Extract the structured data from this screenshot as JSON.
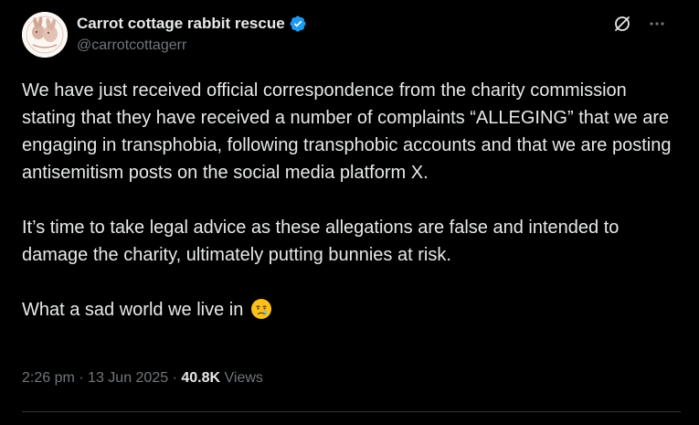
{
  "author": {
    "display_name": "Carrot cottage rabbit rescue",
    "handle": "@carrotcottagerr",
    "verified": true,
    "verified_color": "#1d9bf0"
  },
  "actions": {
    "grok_icon": "grok-icon",
    "more_icon": "more-icon"
  },
  "post": {
    "paragraphs": [
      "We have just received official correspondence from the charity commission stating that they have received a number of complaints “ALLEGING” that we are engaging in transphobia, following transphobic accounts and that we are posting antisemitism posts on the social media platform X.",
      "It’s time to take legal advice as these allegations are false and intended to damage the charity,  ultimately putting bunnies at risk.",
      "What a sad world we live in"
    ],
    "emoji": "crying-face-emoji"
  },
  "meta": {
    "time": "2:26 pm",
    "separator": "·",
    "date": "13 Jun 2025",
    "views_count": "40.8K",
    "views_label": "Views"
  },
  "colors": {
    "background": "#000000",
    "text": "#e7e9ea",
    "secondary": "#71767b",
    "accent": "#1d9bf0"
  }
}
